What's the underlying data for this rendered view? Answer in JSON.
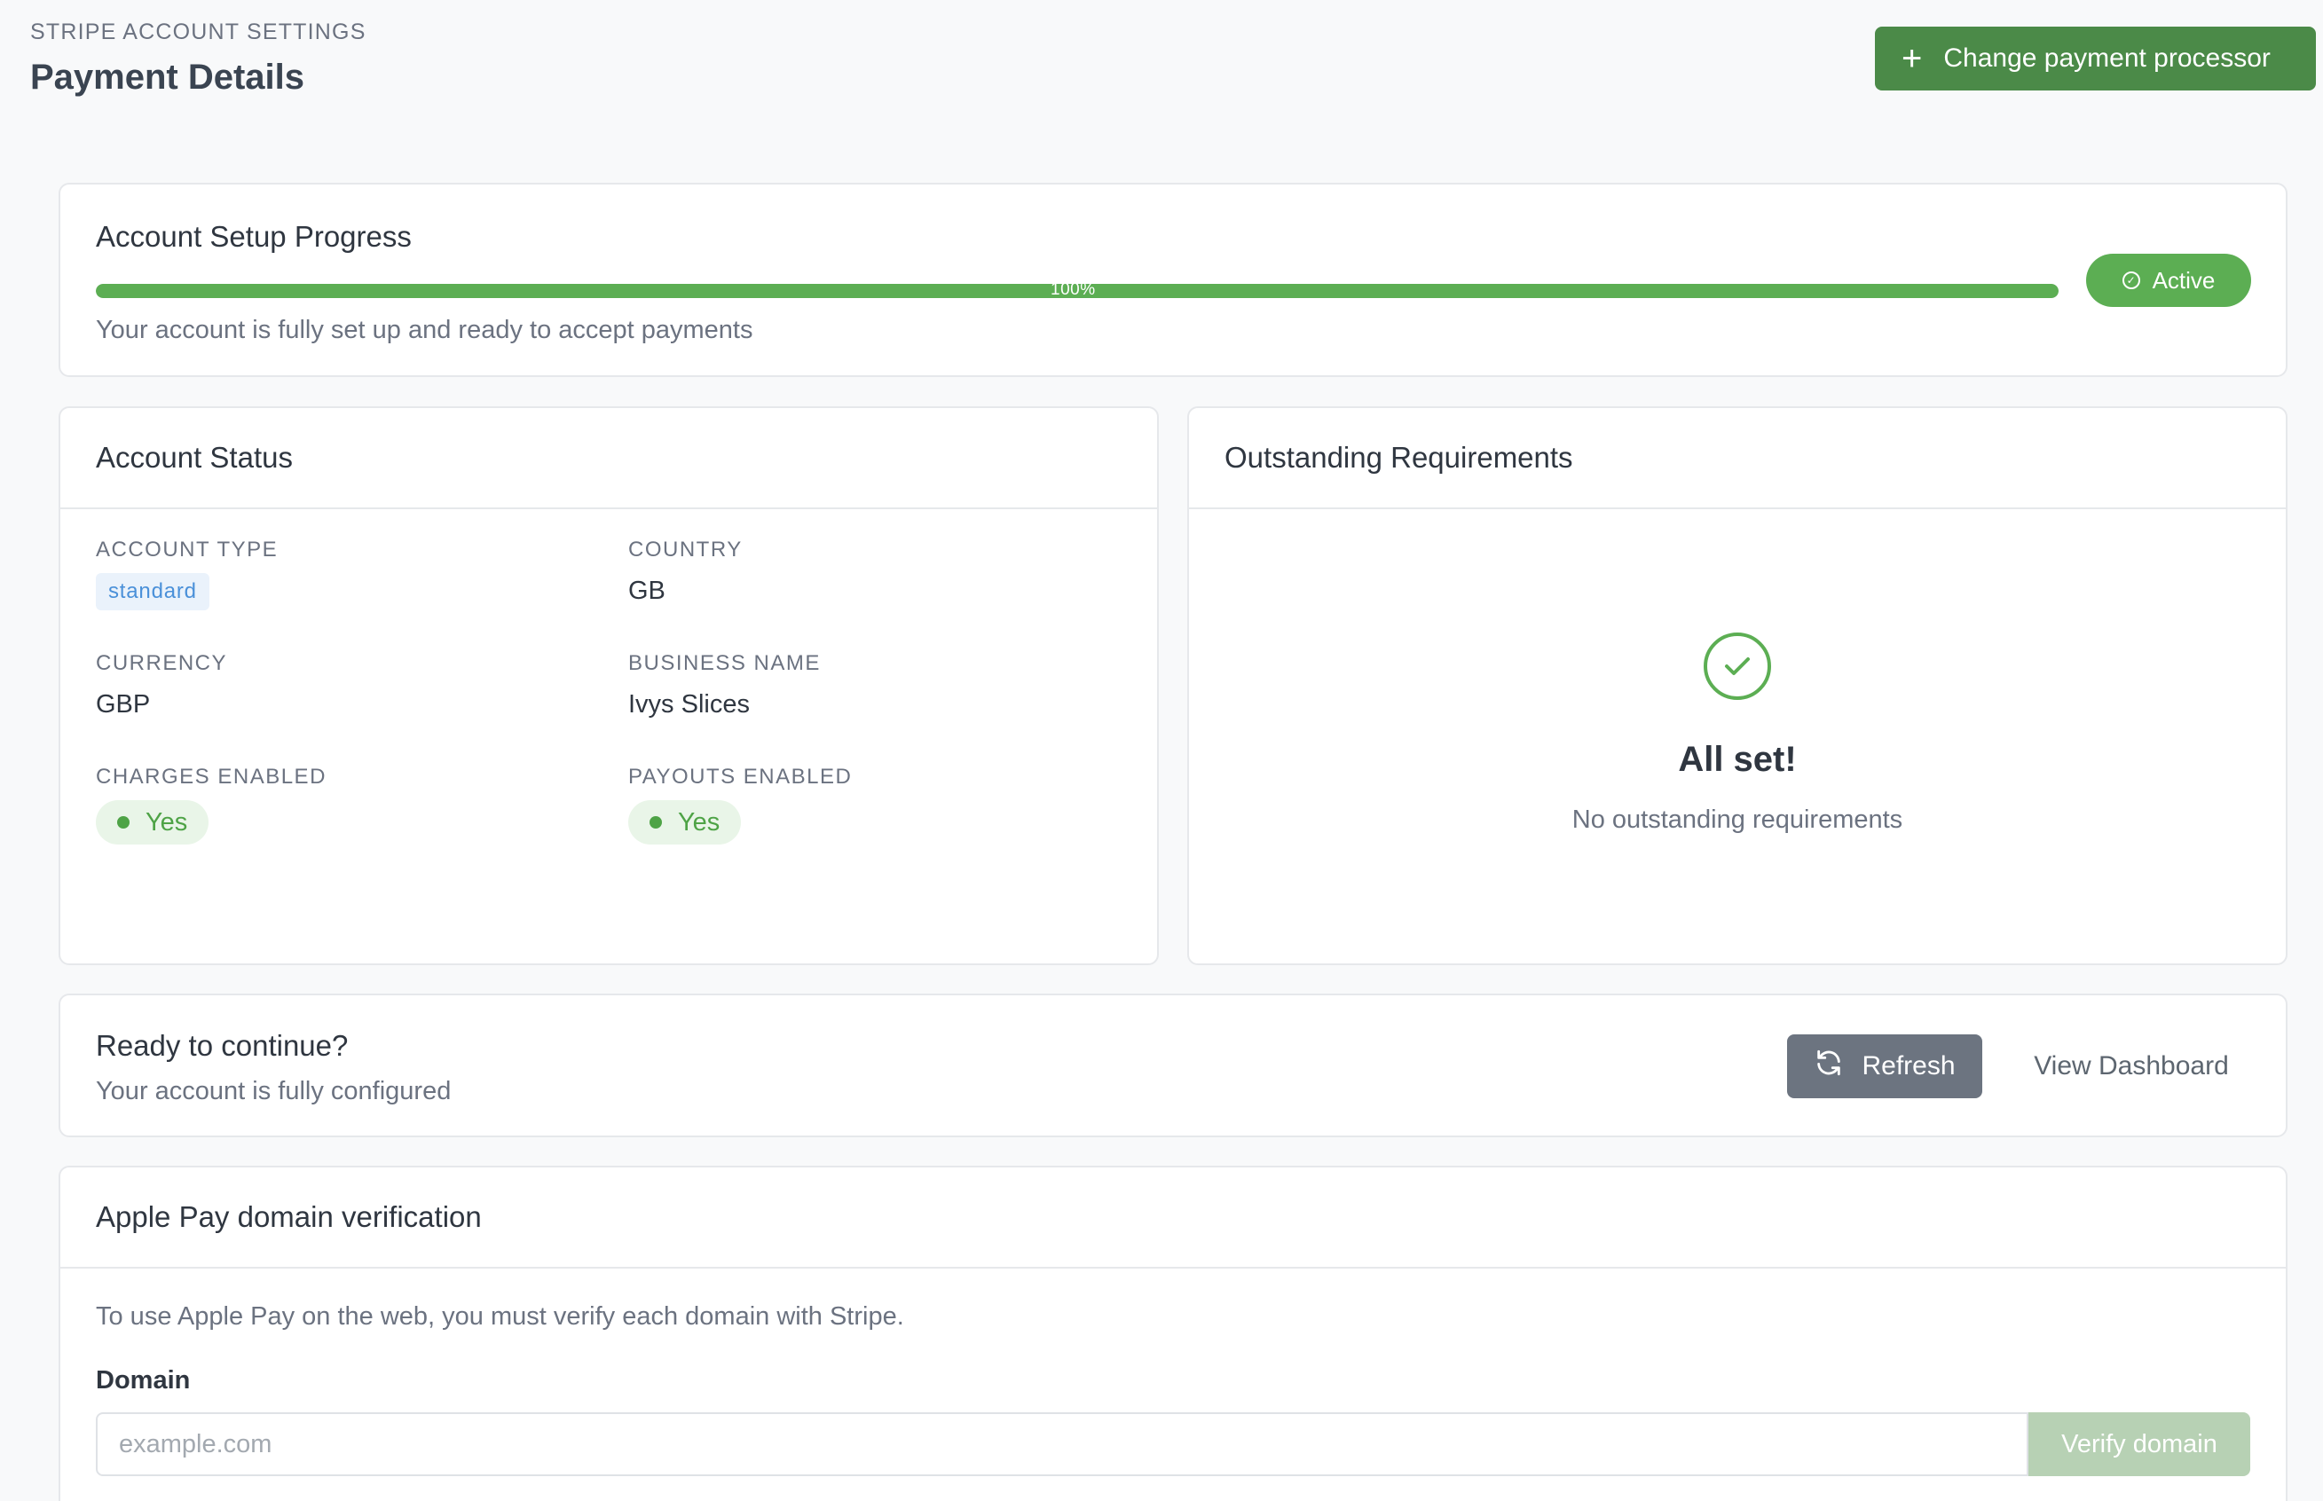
{
  "header": {
    "eyebrow": "STRIPE ACCOUNT SETTINGS",
    "title": "Payment Details",
    "change_processor_label": "Change payment processor"
  },
  "progress": {
    "title": "Account Setup Progress",
    "value_percent": 100,
    "value_label": "100%",
    "description": "Your account is fully set up and ready to accept payments",
    "status_label": "Active"
  },
  "account_status": {
    "title": "Account Status",
    "account_type": {
      "label": "ACCOUNT TYPE",
      "value": "standard"
    },
    "country": {
      "label": "COUNTRY",
      "value": "GB"
    },
    "currency": {
      "label": "CURRENCY",
      "value": "GBP"
    },
    "business_name": {
      "label": "BUSINESS NAME",
      "value": "Ivys Slices"
    },
    "charges_enabled": {
      "label": "CHARGES ENABLED",
      "value": "Yes"
    },
    "payouts_enabled": {
      "label": "PAYOUTS ENABLED",
      "value": "Yes"
    }
  },
  "requirements": {
    "title": "Outstanding Requirements",
    "headline": "All set!",
    "message": "No outstanding requirements"
  },
  "continue": {
    "title": "Ready to continue?",
    "description": "Your account is fully configured",
    "refresh_label": "Refresh",
    "dashboard_label": "View Dashboard"
  },
  "apple_pay": {
    "title": "Apple Pay domain verification",
    "description": "To use Apple Pay on the web, you must verify each domain with Stripe.",
    "domain_label": "Domain",
    "domain_placeholder": "example.com",
    "domain_value": "",
    "verify_label": "Verify domain"
  },
  "colors": {
    "primary_green": "#4b8a48",
    "success_green": "#5cae53",
    "neutral_button": "#6c7480",
    "disabled_green": "#b7d1b4"
  },
  "icons": {
    "change_processor": "plus-icon",
    "active": "check-circle-icon",
    "all_set": "check-circle-icon",
    "refresh": "refresh-icon"
  }
}
